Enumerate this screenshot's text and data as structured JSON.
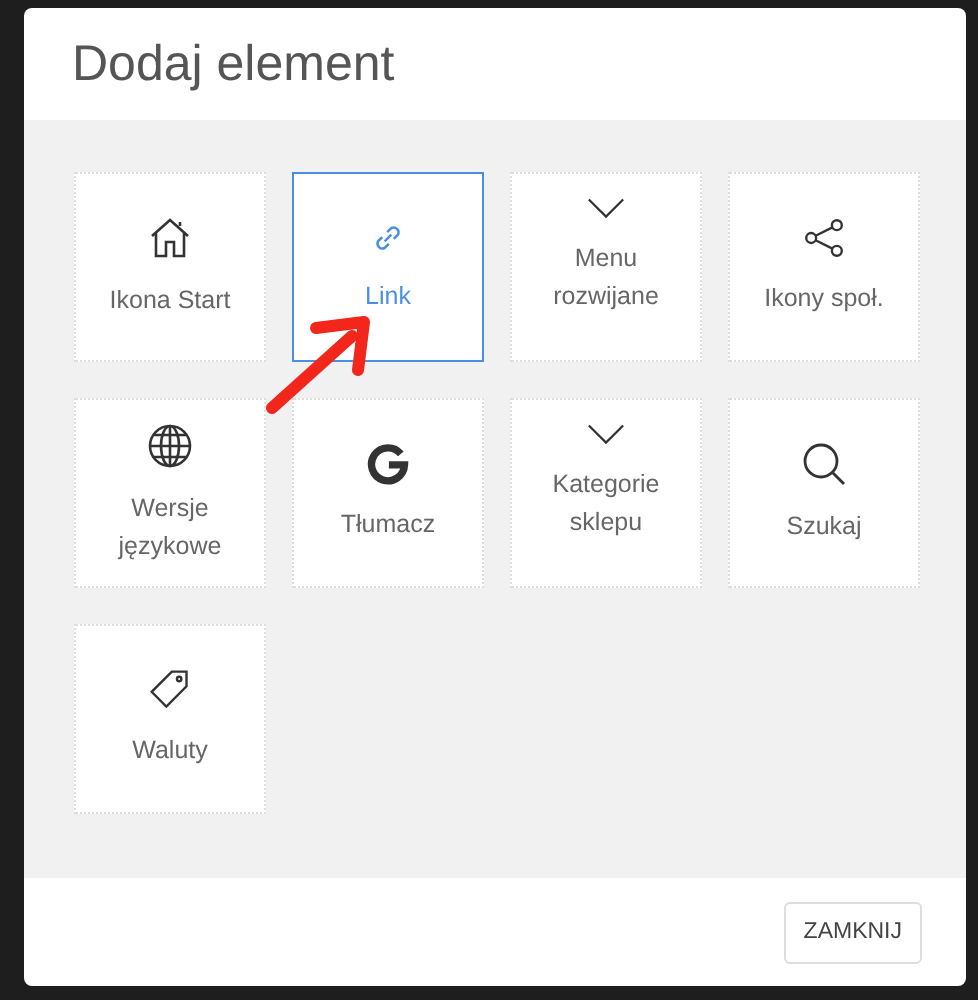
{
  "dialog": {
    "title": "Dodaj element",
    "tiles": [
      {
        "kind": "home",
        "label": "Ikona Start",
        "selected": false
      },
      {
        "kind": "link",
        "label": "Link",
        "selected": true
      },
      {
        "kind": "dropdown",
        "label": "Menu rozwijane",
        "selected": false
      },
      {
        "kind": "share",
        "label": "Ikony społ.",
        "selected": false
      },
      {
        "kind": "globe",
        "label": "Wersje językowe",
        "selected": false
      },
      {
        "kind": "translate",
        "label": "Tłumacz",
        "selected": false
      },
      {
        "kind": "dropdown",
        "label": "Kategorie sklepu",
        "selected": false
      },
      {
        "kind": "search",
        "label": "Szukaj",
        "selected": false
      },
      {
        "kind": "tag",
        "label": "Waluty",
        "selected": false
      }
    ],
    "close_button": "ZAMKNIJ"
  }
}
